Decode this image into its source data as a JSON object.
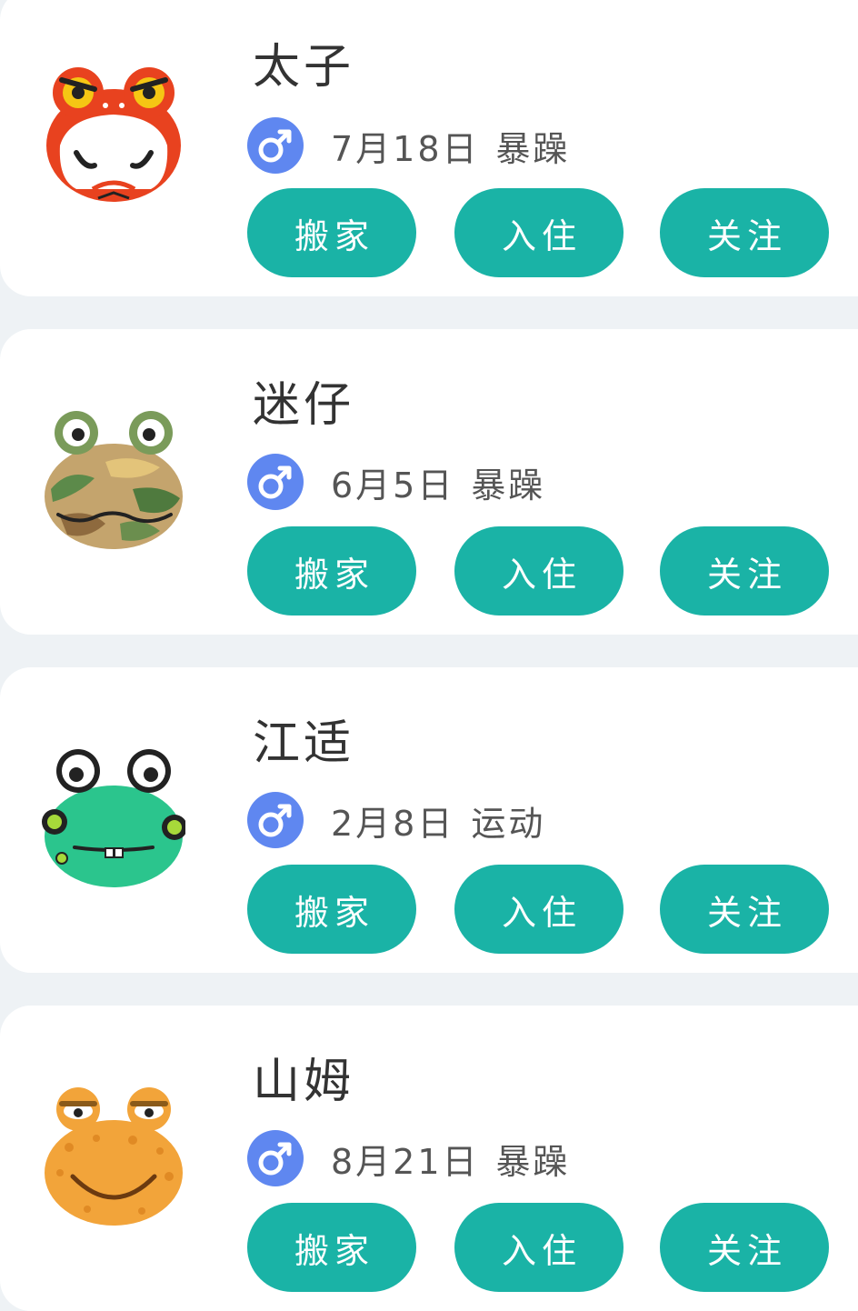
{
  "colors": {
    "button": "#1ab3a6",
    "gender_male": "#5f87f0",
    "background": "#eef2f5",
    "card": "#ffffff"
  },
  "villagers": [
    {
      "name": "太子",
      "gender_icon": "male-icon",
      "birthday": "7月18日",
      "personality": "暴躁",
      "avatar": "red-frog-avatar",
      "buttons": {
        "move_out": "搬家",
        "move_in": "入住",
        "follow": "关注"
      }
    },
    {
      "name": "迷仔",
      "gender_icon": "male-icon",
      "birthday": "6月5日",
      "personality": "暴躁",
      "avatar": "camo-frog-avatar",
      "buttons": {
        "move_out": "搬家",
        "move_in": "入住",
        "follow": "关注"
      }
    },
    {
      "name": "江适",
      "gender_icon": "male-icon",
      "birthday": "2月8日",
      "personality": "运动",
      "avatar": "green-frog-avatar",
      "buttons": {
        "move_out": "搬家",
        "move_in": "入住",
        "follow": "关注"
      }
    },
    {
      "name": "山姆",
      "gender_icon": "male-icon",
      "birthday": "8月21日",
      "personality": "暴躁",
      "avatar": "orange-toad-avatar",
      "buttons": {
        "move_out": "搬家",
        "move_in": "入住",
        "follow": "关注"
      }
    }
  ]
}
